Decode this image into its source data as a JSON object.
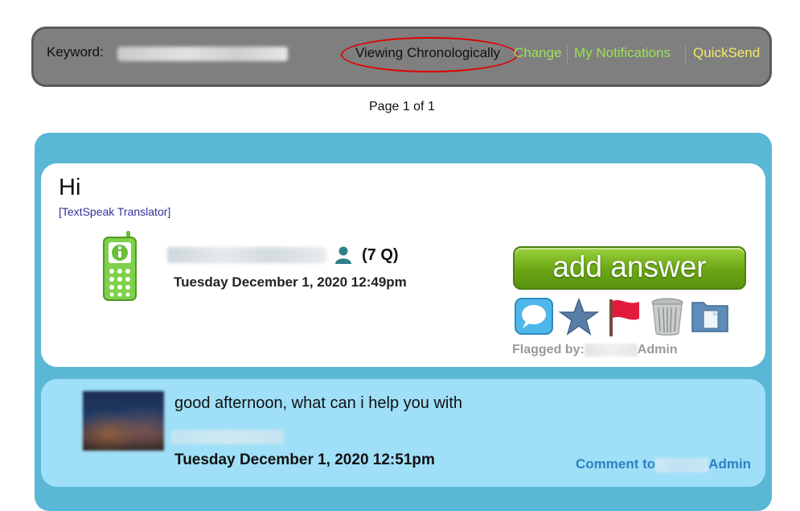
{
  "toolbar": {
    "keyword_label": "Keyword:",
    "viewing_label": "Viewing Chronologically",
    "change_label": "Change",
    "notifications_label": "My Notifications",
    "quicksend_label": "QuickSend"
  },
  "pagination": {
    "text": "Page 1 of 1"
  },
  "question": {
    "title": "Hi",
    "translator_label": "[TextSpeak Translator]",
    "question_count": "(7 Q)",
    "date": "Tuesday December 1, 2020 12:49pm",
    "add_answer_label": "add answer",
    "flagged_by_label": "Flagged by:",
    "flagged_by_user": "Admin",
    "actions": [
      "chat-icon",
      "star-icon",
      "flag-icon",
      "trash-icon",
      "folder-icon"
    ]
  },
  "comment": {
    "text": "good afternoon, what can i help you with",
    "date": "Tuesday December 1, 2020 12:51pm",
    "comment_to_label": "Comment to",
    "comment_to_user": "Admin"
  },
  "colors": {
    "toolbar_bg": "#7f7f7f",
    "link_green": "#9be356",
    "link_yellow": "#f4e96a",
    "panel_blue": "#5ab7d6",
    "comment_bg": "#9fdff7",
    "annotation_red": "#e00000"
  }
}
